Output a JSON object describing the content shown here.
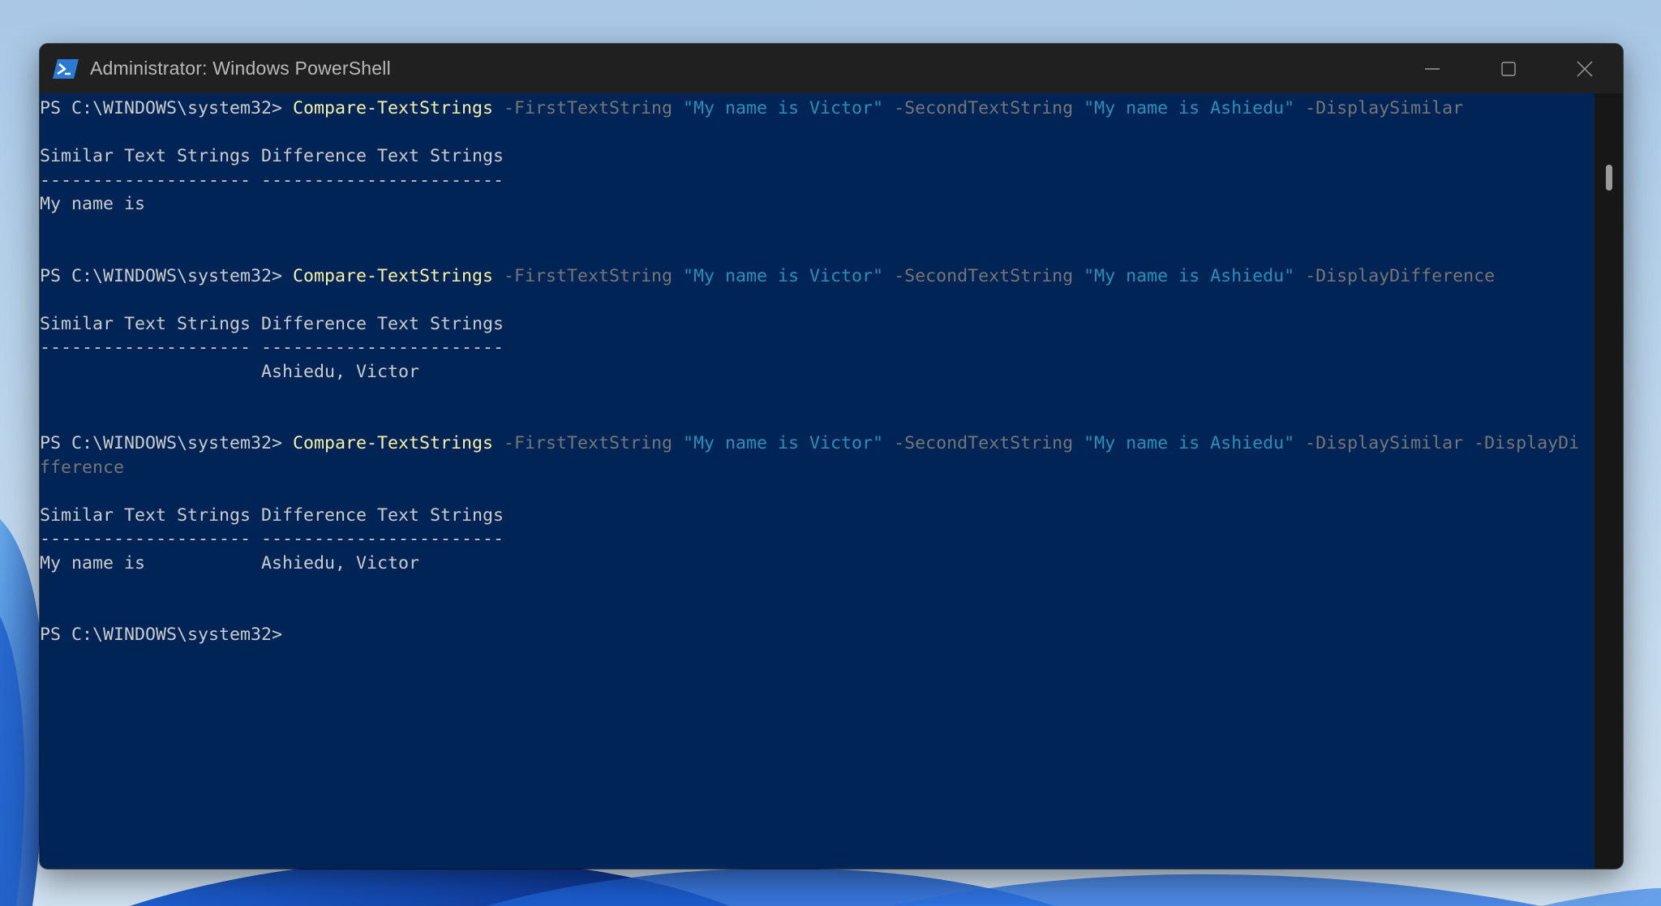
{
  "window": {
    "title": "Administrator: Windows PowerShell",
    "icon": "powershell-icon",
    "controls": [
      "minimize-icon",
      "maximize-icon",
      "close-icon"
    ]
  },
  "colors": {
    "terminal_bg": "#012456",
    "text": "#cccccc",
    "command": "#f9f1a5",
    "parameter": "#767676",
    "string": "#2a8fb8",
    "titlebar": "#202020"
  },
  "terminal": {
    "lines": [
      [
        {
          "t": "PS C:\\WINDOWS\\system32> ",
          "c": "text"
        },
        {
          "t": "Compare-TextStrings",
          "c": "cmd"
        },
        {
          "t": " -FirstTextString ",
          "c": "param"
        },
        {
          "t": "\"My name is Victor\"",
          "c": "str"
        },
        {
          "t": " -SecondTextString ",
          "c": "param"
        },
        {
          "t": "\"My name is Ashiedu\"",
          "c": "str"
        },
        {
          "t": " -DisplaySimilar",
          "c": "param"
        }
      ],
      [],
      [
        {
          "t": "Similar Text Strings Difference Text Strings",
          "c": "text"
        }
      ],
      [
        {
          "t": "-------------------- -----------------------",
          "c": "text"
        }
      ],
      [
        {
          "t": "My name is",
          "c": "text"
        }
      ],
      [],
      [],
      [
        {
          "t": "PS C:\\WINDOWS\\system32> ",
          "c": "text"
        },
        {
          "t": "Compare-TextStrings",
          "c": "cmd"
        },
        {
          "t": " -FirstTextString ",
          "c": "param"
        },
        {
          "t": "\"My name is Victor\"",
          "c": "str"
        },
        {
          "t": " -SecondTextString ",
          "c": "param"
        },
        {
          "t": "\"My name is Ashiedu\"",
          "c": "str"
        },
        {
          "t": " -DisplayDifference",
          "c": "param"
        }
      ],
      [],
      [
        {
          "t": "Similar Text Strings Difference Text Strings",
          "c": "text"
        }
      ],
      [
        {
          "t": "-------------------- -----------------------",
          "c": "text"
        }
      ],
      [
        {
          "t": "                     Ashiedu, Victor",
          "c": "text"
        }
      ],
      [],
      [],
      [
        {
          "t": "PS C:\\WINDOWS\\system32> ",
          "c": "text"
        },
        {
          "t": "Compare-TextStrings",
          "c": "cmd"
        },
        {
          "t": " -FirstTextString ",
          "c": "param"
        },
        {
          "t": "\"My name is Victor\"",
          "c": "str"
        },
        {
          "t": " -SecondTextString ",
          "c": "param"
        },
        {
          "t": "\"My name is Ashiedu\"",
          "c": "str"
        },
        {
          "t": " -DisplaySimilar -DisplayDi",
          "c": "param"
        }
      ],
      [
        {
          "t": "fference",
          "c": "param"
        }
      ],
      [],
      [
        {
          "t": "Similar Text Strings Difference Text Strings",
          "c": "text"
        }
      ],
      [
        {
          "t": "-------------------- -----------------------",
          "c": "text"
        }
      ],
      [
        {
          "t": "My name is           Ashiedu, Victor",
          "c": "text"
        }
      ],
      [],
      [],
      [
        {
          "t": "PS C:\\WINDOWS\\system32>",
          "c": "text"
        }
      ]
    ]
  }
}
